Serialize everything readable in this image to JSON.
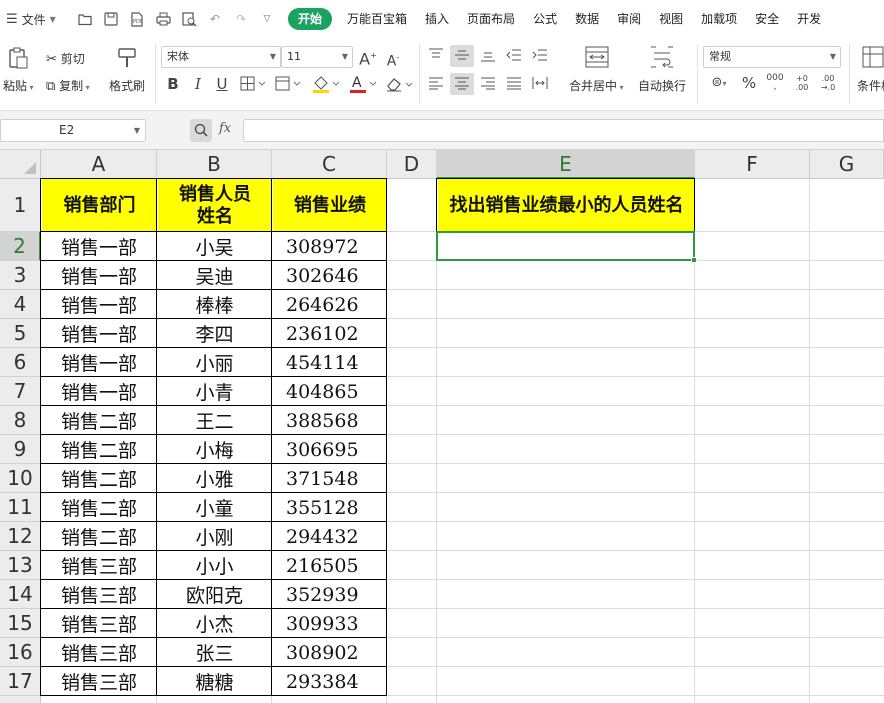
{
  "menubar": {
    "file_label": "文件",
    "tabs": [
      {
        "label": "开始",
        "active": true
      },
      {
        "label": "万能百宝箱"
      },
      {
        "label": "插入"
      },
      {
        "label": "页面布局"
      },
      {
        "label": "公式"
      },
      {
        "label": "数据"
      },
      {
        "label": "审阅"
      },
      {
        "label": "视图"
      },
      {
        "label": "加载项"
      },
      {
        "label": "安全"
      },
      {
        "label": "开发"
      }
    ],
    "accent_color": "#1aa260"
  },
  "ribbon": {
    "paste_label": "粘贴",
    "cut_label": "剪切",
    "copy_label": "复制",
    "format_painter_label": "格式刷",
    "font_name": "宋体",
    "font_size": "11",
    "bold": "B",
    "italic": "I",
    "underline": "U",
    "merge_center_label": "合并居中",
    "wrap_text_label": "自动换行",
    "number_format": "常规",
    "conditional_label": "条件格"
  },
  "formula_bar": {
    "name_box": "E2",
    "fx": "fx",
    "formula": ""
  },
  "sheet": {
    "columns": [
      "A",
      "B",
      "C",
      "D",
      "E",
      "F",
      "G"
    ],
    "active_column": "E",
    "active_row": "2",
    "header_row": {
      "a": "销售部门",
      "b": "销售人员姓名",
      "c": "销售业绩",
      "e": "找出销售业绩最小的人员姓名"
    },
    "rows": [
      {
        "n": "2",
        "a": "销售一部",
        "b": "小吴",
        "c": "308972"
      },
      {
        "n": "3",
        "a": "销售一部",
        "b": "吴迪",
        "c": "302646"
      },
      {
        "n": "4",
        "a": "销售一部",
        "b": "棒棒",
        "c": "264626"
      },
      {
        "n": "5",
        "a": "销售一部",
        "b": "李四",
        "c": "236102"
      },
      {
        "n": "6",
        "a": "销售一部",
        "b": "小丽",
        "c": "454114"
      },
      {
        "n": "7",
        "a": "销售一部",
        "b": "小青",
        "c": "404865"
      },
      {
        "n": "8",
        "a": "销售二部",
        "b": "王二",
        "c": "388568"
      },
      {
        "n": "9",
        "a": "销售二部",
        "b": "小梅",
        "c": "306695"
      },
      {
        "n": "10",
        "a": "销售二部",
        "b": "小雅",
        "c": "371548"
      },
      {
        "n": "11",
        "a": "销售二部",
        "b": "小童",
        "c": "355128"
      },
      {
        "n": "12",
        "a": "销售二部",
        "b": "小刚",
        "c": "294432"
      },
      {
        "n": "13",
        "a": "销售三部",
        "b": "小小",
        "c": "216505"
      },
      {
        "n": "14",
        "a": "销售三部",
        "b": "欧阳克",
        "c": "352939"
      },
      {
        "n": "15",
        "a": "销售三部",
        "b": "小杰",
        "c": "309933"
      },
      {
        "n": "16",
        "a": "销售三部",
        "b": "张三",
        "c": "308902"
      },
      {
        "n": "17",
        "a": "销售三部",
        "b": "糖糖",
        "c": "293384"
      }
    ],
    "header_fill": "#ffff00",
    "selection_color": "#2e9b43"
  }
}
